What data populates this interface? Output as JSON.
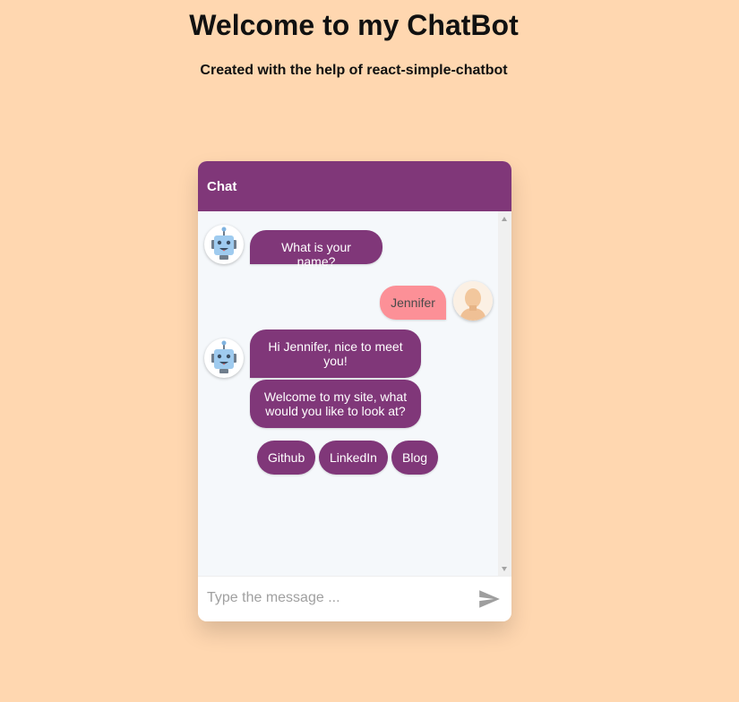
{
  "page": {
    "title": "Welcome to my ChatBot",
    "subtitle": "Created with the help of react-simple-chatbot"
  },
  "chat": {
    "header_title": "Chat",
    "messages": [
      {
        "from": "bot",
        "text": "What is your name?"
      },
      {
        "from": "user",
        "text": "Jennifer"
      },
      {
        "from": "bot",
        "text": "Hi Jennifer, nice to meet you!"
      },
      {
        "from": "bot",
        "text": "Welcome to my site, what would you like to look at?"
      }
    ],
    "options": [
      "Github",
      "LinkedIn",
      "Blog"
    ],
    "input_placeholder": "Type the message ...",
    "icons": {
      "bot_avatar": "robot-icon",
      "user_avatar": "user-icon",
      "send": "send-icon"
    }
  },
  "colors": {
    "page_background": "#ffd7b0",
    "header_background": "#803779",
    "bot_bubble": "#803779",
    "user_bubble": "#fc9097",
    "chat_background": "#f5f8fb"
  }
}
